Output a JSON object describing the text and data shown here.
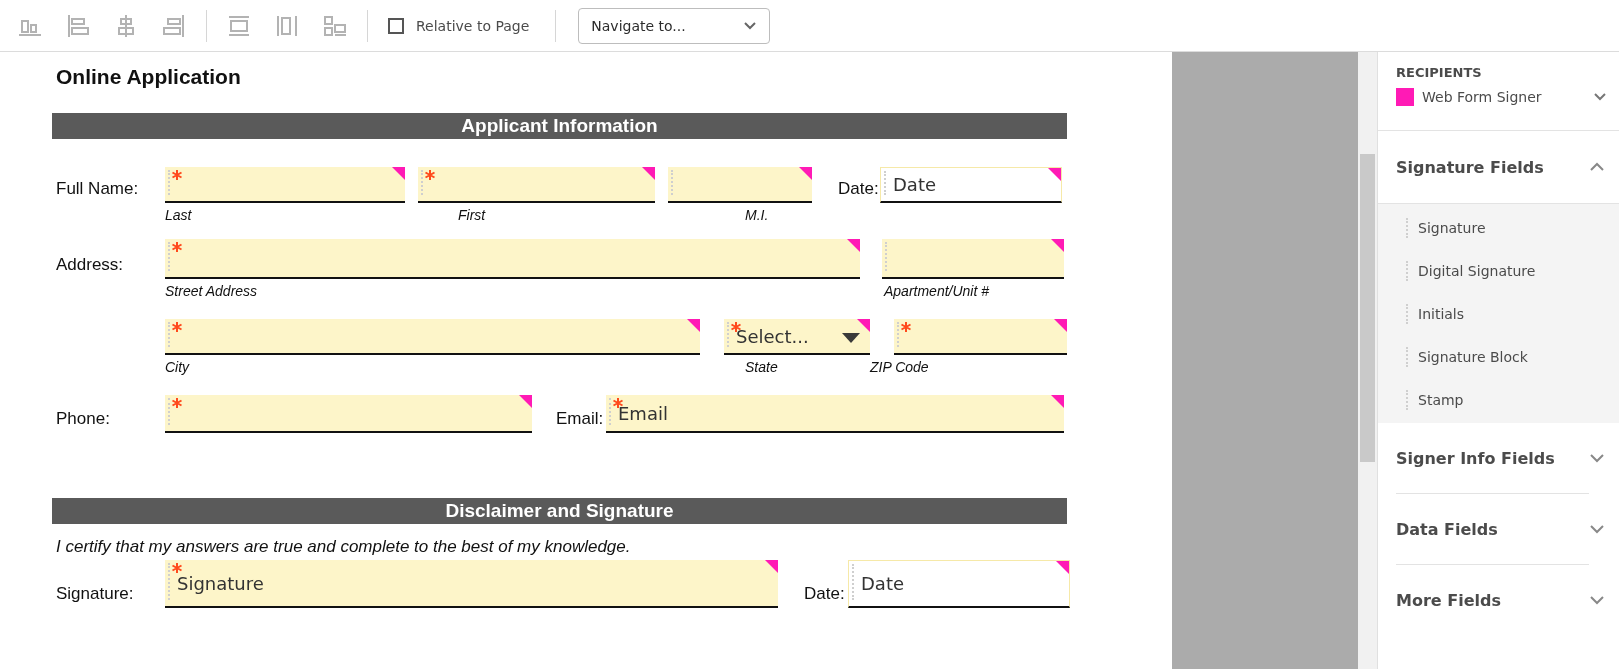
{
  "toolbar": {
    "relative_to_page": {
      "label": "Relative to Page",
      "checked": false
    },
    "navigate": {
      "value": "Navigate to..."
    }
  },
  "document": {
    "title": "Online Application",
    "sections": [
      {
        "heading": "Applicant Information",
        "rows": [
          {
            "items": [
              {
                "kind": "label",
                "text": "Full Name:"
              },
              {
                "kind": "text",
                "required": true,
                "caption": "Last"
              },
              {
                "kind": "text",
                "required": true,
                "caption": "First"
              },
              {
                "kind": "text",
                "required": false,
                "caption": "M.I."
              },
              {
                "kind": "label",
                "text": "Date:"
              },
              {
                "kind": "date",
                "required": false,
                "text": "Date"
              }
            ]
          },
          {
            "items": [
              {
                "kind": "label",
                "text": "Address:"
              },
              {
                "kind": "text",
                "required": true,
                "caption": "Street Address"
              },
              {
                "kind": "text",
                "required": false,
                "caption": "Apartment/Unit #"
              }
            ]
          },
          {
            "items": [
              {
                "kind": "text",
                "required": true,
                "caption": "City"
              },
              {
                "kind": "select",
                "required": true,
                "text": "Select...",
                "caption": "State"
              },
              {
                "kind": "text",
                "required": true,
                "caption": "ZIP Code"
              }
            ]
          },
          {
            "items": [
              {
                "kind": "label",
                "text": "Phone:"
              },
              {
                "kind": "text",
                "required": true
              },
              {
                "kind": "label",
                "text": "Email:"
              },
              {
                "kind": "text",
                "required": true,
                "text": "Email"
              }
            ]
          }
        ]
      },
      {
        "heading": "Disclaimer and Signature",
        "note": "I certify that my answers are true and complete to the best of my knowledge.",
        "rows": [
          {
            "items": [
              {
                "kind": "label",
                "text": "Signature:"
              },
              {
                "kind": "text",
                "required": true,
                "text": "Signature"
              },
              {
                "kind": "label",
                "text": "Date:"
              },
              {
                "kind": "date",
                "required": false,
                "text": "Date"
              }
            ]
          }
        ]
      }
    ]
  },
  "side_panel": {
    "recipients_label": "RECIPIENTS",
    "recipient": {
      "name": "Web Form Signer",
      "color": "#ff1ab5"
    },
    "sections": [
      {
        "title": "Signature Fields",
        "expanded": true,
        "items": [
          "Signature",
          "Digital Signature",
          "Initials",
          "Signature Block",
          "Stamp"
        ]
      },
      {
        "title": "Signer Info Fields",
        "expanded": false
      },
      {
        "title": "Data Fields",
        "expanded": false
      },
      {
        "title": "More Fields",
        "expanded": false
      }
    ]
  }
}
